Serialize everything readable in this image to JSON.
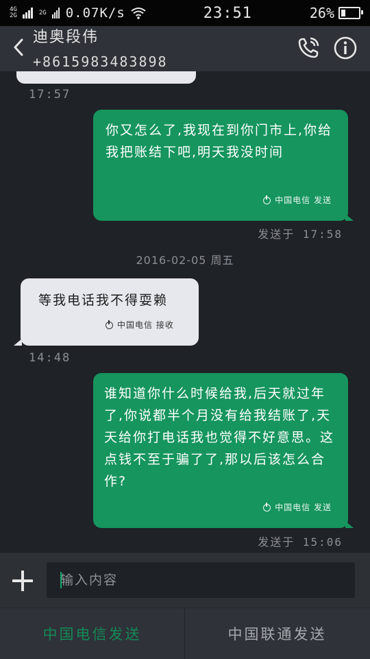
{
  "status_bar": {
    "signal_top": "4G",
    "signal_bottom": "2G",
    "signal_top2": "2G",
    "speed": "0.07K/s",
    "time": "23:51",
    "battery": "26%",
    "battery_level": 0.26
  },
  "header": {
    "contact_name": "迪奥段伟",
    "contact_number": "+8615983483898"
  },
  "messages": [
    {
      "direction": "outgoing",
      "text": "你又怎么了,我现在到你门市上,你给我把账结下吧,明天我没时间",
      "sim_label": "中国电信 发送",
      "time": "发送于 17:58"
    },
    {
      "direction": "incoming",
      "text": "等我电话我不得耍赖",
      "sim_label": "中国电信 接收",
      "time": "14:48"
    },
    {
      "direction": "outgoing",
      "text": "谁知道你什么时候给我,后天就过年了,你说都半个月没有给我结账了,天天给你打电话我也觉得不好意思。这点钱不至于骗了了,那以后该怎么合作?",
      "sim_label": "中国电信 发送",
      "time": "发送于 15:06"
    }
  ],
  "prev_time": "17:57",
  "date_separator": "2016-02-05 周五",
  "composer": {
    "placeholder": "输入内容"
  },
  "send_bar": {
    "telecom_label": "中国电信发送",
    "unicom_label": "中国联通发送"
  },
  "colors": {
    "outgoing_bubble": "#16955e",
    "incoming_bubble": "#e7e8ee",
    "background": "#1f2227"
  }
}
